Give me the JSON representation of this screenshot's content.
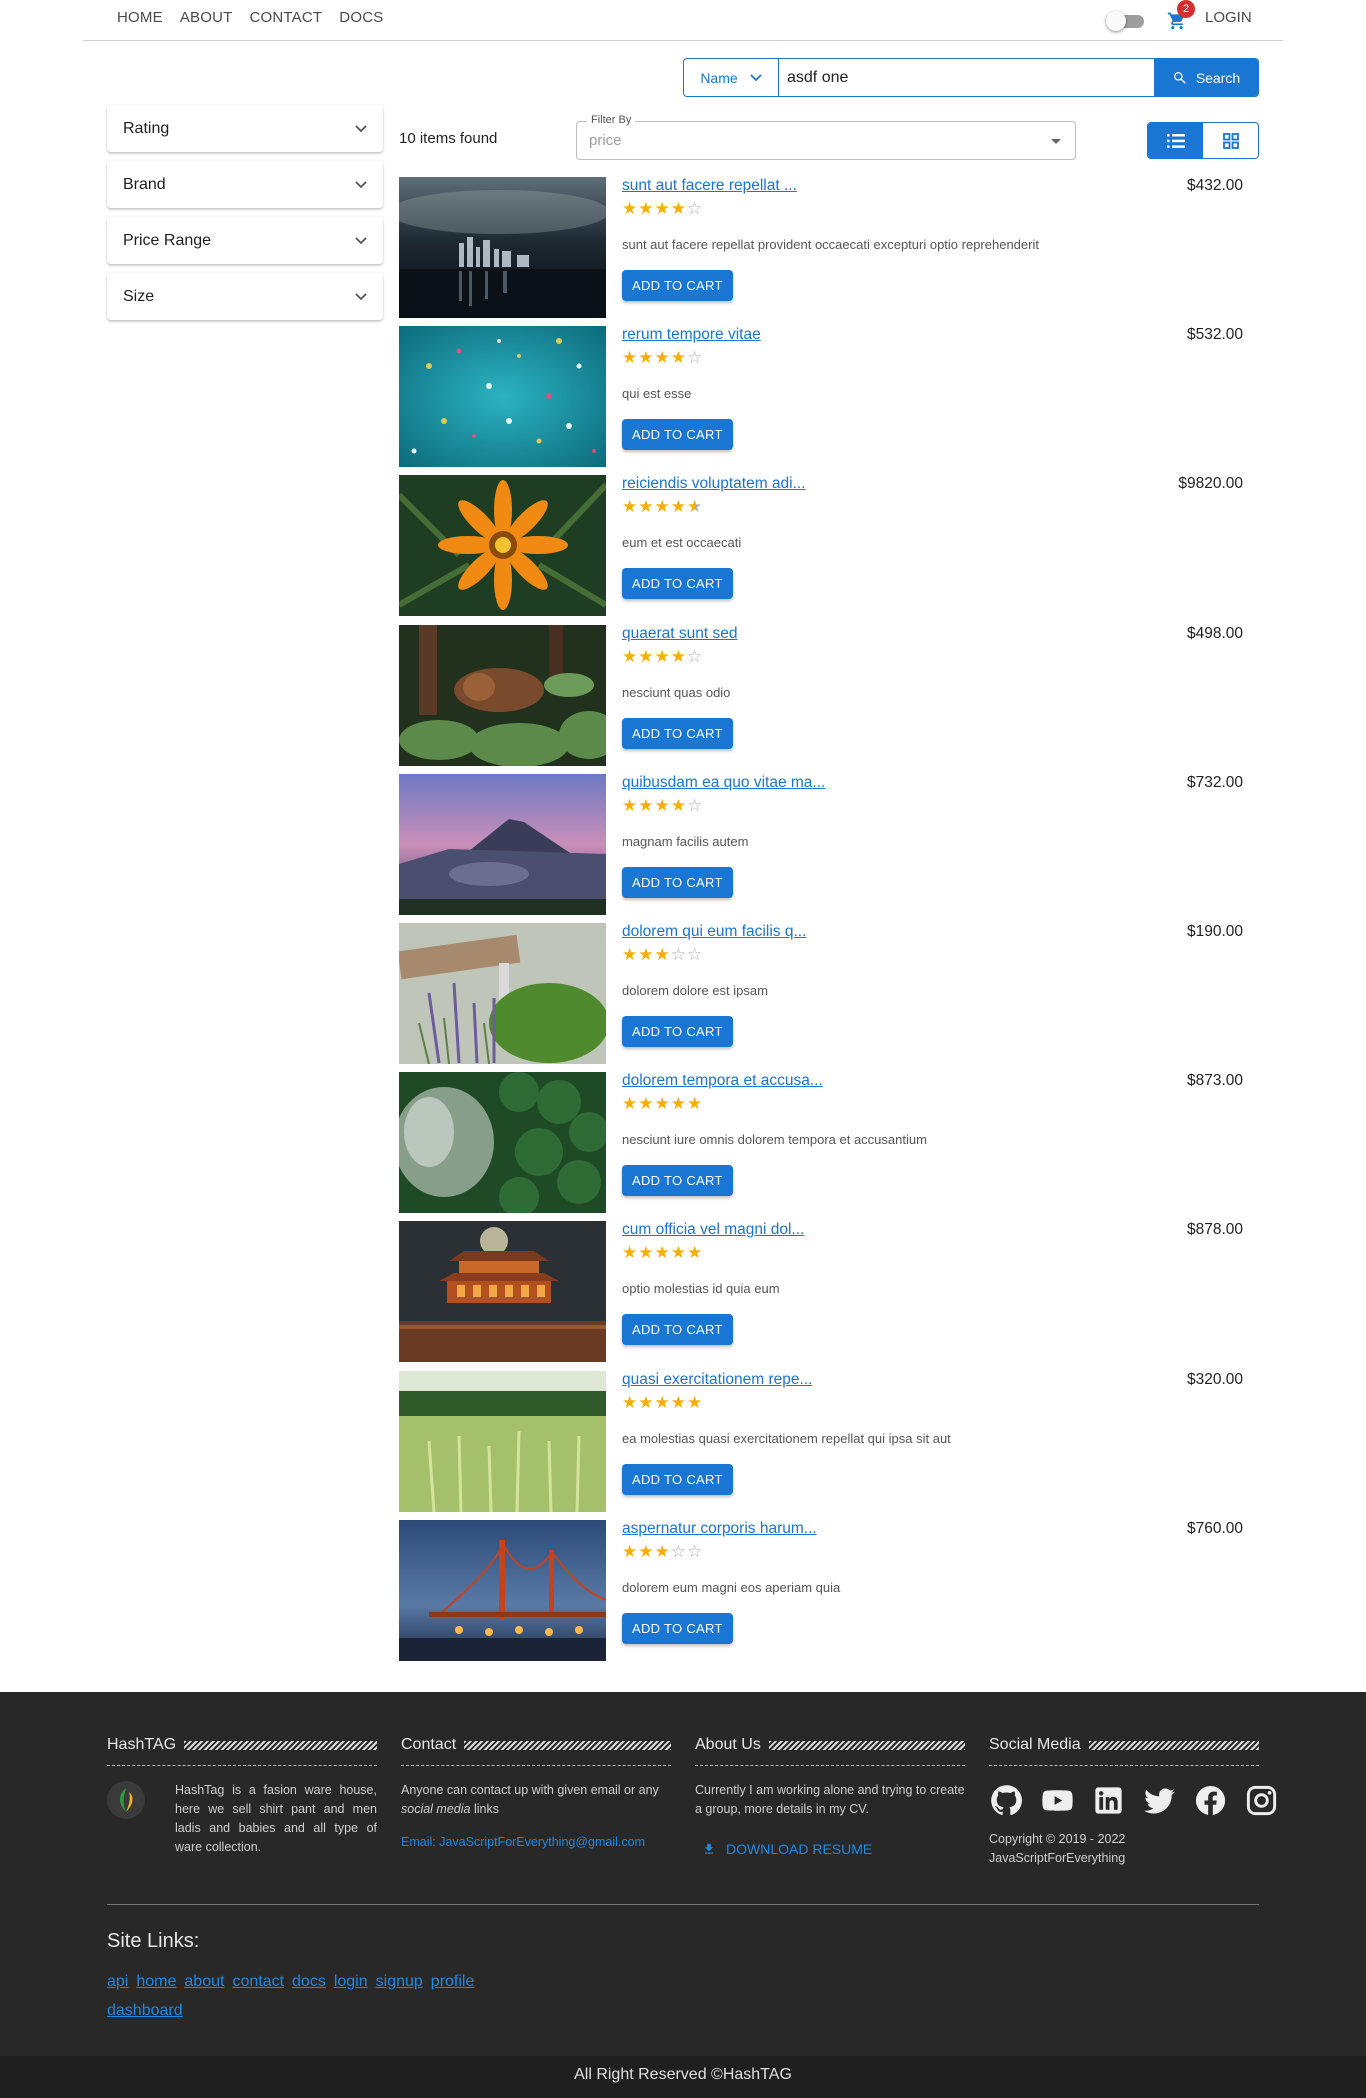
{
  "nav": {
    "links": [
      "HOME",
      "ABOUT",
      "CONTACT",
      "DOCS"
    ],
    "login": "LOGIN",
    "cart_count": "2"
  },
  "search": {
    "type": "Name",
    "value": "asdf one",
    "button": "Search"
  },
  "filters": {
    "sections": [
      "Rating",
      "Brand",
      "Price Range",
      "Size"
    ]
  },
  "results": {
    "count_text": "10 items found",
    "filter_label": "Filter By",
    "filter_value": "price",
    "view": "list"
  },
  "items": [
    {
      "title": "sunt aut facere repellat ...",
      "rating": 4,
      "desc": "sunt aut facere repellat provident occaecati excepturi optio reprehenderit",
      "price": "$432.00",
      "button": "ADD TO CART"
    },
    {
      "title": "rerum tempore vitae",
      "rating": 4,
      "desc": "qui est esse",
      "price": "$532.00",
      "button": "ADD TO CART"
    },
    {
      "title": "reiciendis voluptatem adi...",
      "rating": 4.5,
      "desc": "eum et est occaecati",
      "price": "$9820.00",
      "button": "ADD TO CART"
    },
    {
      "title": "quaerat sunt sed",
      "rating": 4,
      "desc": "nesciunt quas odio",
      "price": "$498.00",
      "button": "ADD TO CART"
    },
    {
      "title": "quibusdam ea quo vitae ma...",
      "rating": 4,
      "desc": "magnam facilis autem",
      "price": "$732.00",
      "button": "ADD TO CART"
    },
    {
      "title": "dolorem qui eum facilis q...",
      "rating": 3,
      "desc": "dolorem dolore est ipsam",
      "price": "$190.00",
      "button": "ADD TO CART"
    },
    {
      "title": "dolorem tempora et accusa...",
      "rating": 5,
      "desc": "nesciunt iure omnis dolorem tempora et accusantium",
      "price": "$873.00",
      "button": "ADD TO CART"
    },
    {
      "title": "cum officia vel magni dol...",
      "rating": 5,
      "desc": "optio molestias id quia eum",
      "price": "$878.00",
      "button": "ADD TO CART"
    },
    {
      "title": "quasi exercitationem repe...",
      "rating": 5,
      "desc": "ea molestias quasi exercitationem repellat qui ipsa sit aut",
      "price": "$320.00",
      "button": "ADD TO CART"
    },
    {
      "title": "aspernatur corporis harum...",
      "rating": 3,
      "desc": "dolorem eum magni eos aperiam quia",
      "price": "$760.00",
      "button": "ADD TO CART"
    }
  ],
  "footer": {
    "hashtag": {
      "heading": "HashTAG",
      "text": "HashTag is a fasion ware house, here we sell shirt pant and men ladis and babies and all type of ware collection."
    },
    "contact": {
      "heading": "Contact",
      "text_a": "Anyone can contact up with given email or any",
      "text_em": "social media",
      "text_b": "links",
      "email": "Email: JavaScriptForEverything@gmail.com"
    },
    "about": {
      "heading": "About Us",
      "text": "Currently I am working alone and trying to create a group, more details in my CV.",
      "download": "DOWNLOAD RESUME"
    },
    "social": {
      "heading": "Social Media",
      "icons": [
        "github-icon",
        "youtube-icon",
        "linkedin-icon",
        "twitter-icon",
        "facebook-icon",
        "instagram-icon"
      ],
      "copyright_1": "Copyright © 2019 - 2022",
      "copyright_2": "JavaScriptForEverything"
    },
    "site_links_heading": "Site Links:",
    "site_links": [
      "api",
      "home",
      "about",
      "contact",
      "docs",
      "login",
      "signup",
      "profile",
      "dashboard"
    ],
    "rights": "All Right Reserved ©HashTAG"
  },
  "colors": {
    "primary": "#1976d2",
    "star": "#faaf00",
    "footer_bg": "#282828",
    "badge": "#d32f2f"
  }
}
